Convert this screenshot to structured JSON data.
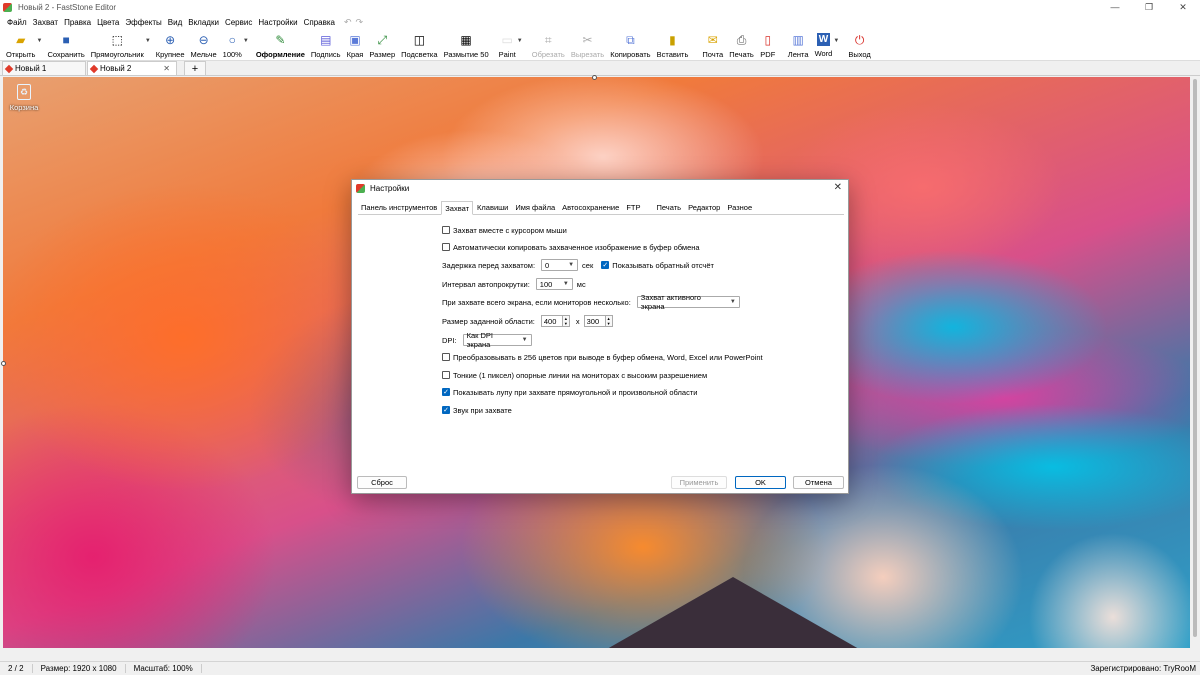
{
  "window": {
    "title": "Новый 2 - FastStone Editor"
  },
  "menu": [
    "Файл",
    "Захват",
    "Правка",
    "Цвета",
    "Эффекты",
    "Вид",
    "Вкладки",
    "Сервис",
    "Настройки",
    "Справка"
  ],
  "toolbar": [
    {
      "label": "Открыть",
      "icon": "open-folder-icon",
      "glyph": "📂"
    },
    {
      "label": "Сохранить",
      "icon": "save-icon",
      "glyph": "💾"
    },
    {
      "label": "Прямоугольник",
      "icon": "rectangle-select-icon",
      "glyph": "⬚"
    },
    {
      "label": "Крупнее",
      "icon": "zoom-in-icon",
      "glyph": "⊕"
    },
    {
      "label": "Мельче",
      "icon": "zoom-out-icon",
      "glyph": "⊖"
    },
    {
      "label": "100%",
      "icon": "zoom-100-icon",
      "glyph": "🔍"
    },
    {
      "label": "Оформление",
      "icon": "draw-icon",
      "glyph": "✎"
    },
    {
      "label": "Подпись",
      "icon": "caption-icon",
      "glyph": "▤"
    },
    {
      "label": "Края",
      "icon": "edges-icon",
      "glyph": "▣"
    },
    {
      "label": "Размер",
      "icon": "resize-icon",
      "glyph": "⤢"
    },
    {
      "label": "Подсветка",
      "icon": "spotlight-icon",
      "glyph": "◫"
    },
    {
      "label": "Размытие 50",
      "icon": "blur-icon",
      "glyph": "▦"
    },
    {
      "label": "Paint",
      "icon": "paint-icon",
      "glyph": "▭"
    },
    {
      "label": "Обрезать",
      "icon": "crop-icon",
      "glyph": "⌗"
    },
    {
      "label": "Вырезать",
      "icon": "cut-icon",
      "glyph": "✂"
    },
    {
      "label": "Копировать",
      "icon": "copy-icon",
      "glyph": "⧉"
    },
    {
      "label": "Вставить",
      "icon": "paste-icon",
      "glyph": "📋"
    },
    {
      "label": "Почта",
      "icon": "mail-icon",
      "glyph": "✉"
    },
    {
      "label": "Печать",
      "icon": "print-icon",
      "glyph": "🖶"
    },
    {
      "label": "PDF",
      "icon": "pdf-icon",
      "glyph": "📄"
    },
    {
      "label": "Лента",
      "icon": "filmstrip-icon",
      "glyph": "▥"
    },
    {
      "label": "Word",
      "icon": "word-icon",
      "glyph": "W"
    },
    {
      "label": "Выход",
      "icon": "power-icon",
      "glyph": "⏻"
    }
  ],
  "tabs": [
    {
      "label": "Новый 1"
    },
    {
      "label": "Новый 2"
    }
  ],
  "desktop": {
    "recycle_label": "Корзина"
  },
  "dialog": {
    "title": "Настройки",
    "tabs": [
      "Панель инструментов",
      "Захват",
      "Клавиши",
      "Имя файла",
      "Автосохранение",
      "FTP",
      "Печать",
      "Редактор",
      "Разное"
    ],
    "active_tab": "Захват",
    "capture_cursor": "Захват вместе с курсором мыши",
    "auto_copy": "Автоматически копировать захваченное изображение в буфер обмена",
    "delay_label": "Задержка перед захватом:",
    "delay_value": "0",
    "delay_unit": "сек",
    "countdown_label": "Показывать обратный отсчёт",
    "autoscroll_label": "Интервал автопрокрутки:",
    "autoscroll_value": "100",
    "autoscroll_unit": "мс",
    "multi_monitor_label": "При захвате всего экрана, если мониторов несколько:",
    "multi_monitor_value": "Захват активного экрана",
    "region_label": "Размер заданной области:",
    "region_w": "400",
    "region_x": "x",
    "region_h": "300",
    "dpi_label": "DPI:",
    "dpi_value": "Как DPI экрана",
    "convert256": "Преобразовывать в 256 цветов при выводе в буфер обмена, Word, Excel или PowerPoint",
    "thin_lines": "Тонкие (1 пиксел) опорные линии на мониторах с высоким разрешением",
    "magnifier": "Показывать лупу при захвате прямоугольной и произвольной области",
    "sound": "Звук при захвате",
    "btn_reset": "Сброс",
    "btn_apply": "Применить",
    "btn_ok": "OK",
    "btn_cancel": "Отмена"
  },
  "status": {
    "pages": "2 / 2",
    "size": "Размер: 1920 x 1080",
    "scale": "Масштаб: 100%",
    "registered": "Зарегистрировано: TryRooM"
  }
}
